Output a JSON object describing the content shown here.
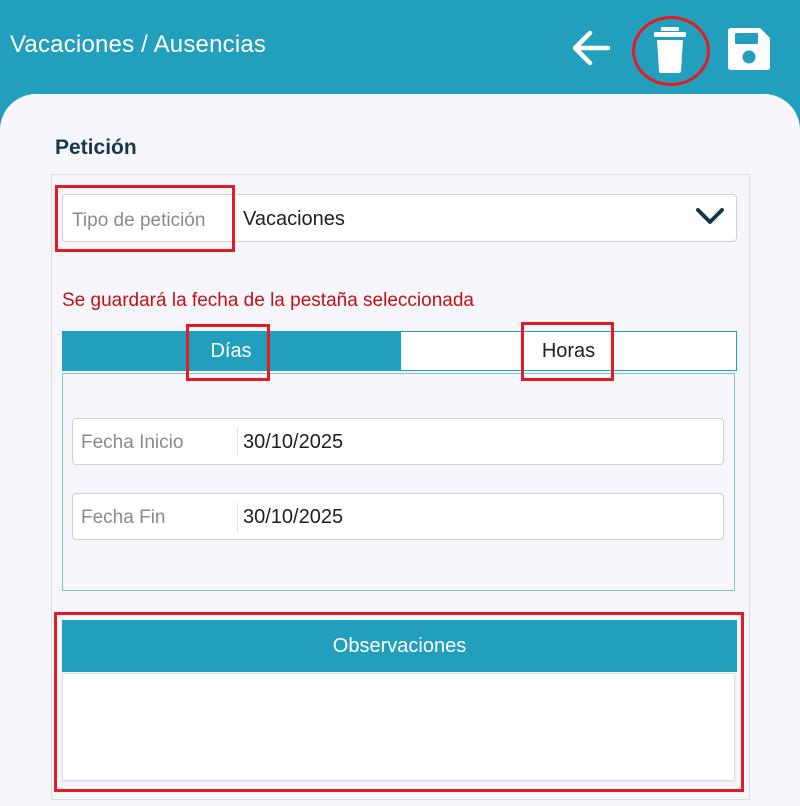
{
  "header": {
    "title": "Vacaciones / Ausencias",
    "back_icon": "arrow-left-icon",
    "delete_icon": "trash-icon",
    "save_icon": "floppy-disk-icon"
  },
  "form": {
    "section_title": "Petición",
    "request_type": {
      "label": "Tipo de petición",
      "value": "Vacaciones",
      "icon": "chevron-down-icon"
    },
    "notice": "Se guardará la fecha de la pestaña seleccionada",
    "tabs": [
      {
        "label": "Días",
        "selected": true
      },
      {
        "label": "Horas",
        "selected": false
      }
    ],
    "dates": {
      "start": {
        "label": "Fecha Inicio",
        "value": "30/10/2025"
      },
      "end": {
        "label": "Fecha Fin",
        "value": "30/10/2025"
      }
    },
    "observations": {
      "label": "Observaciones",
      "value": ""
    }
  },
  "colors": {
    "primary": "#229fbd",
    "sheet_background": "#f7f6fc",
    "notice_text": "#c21212",
    "highlight": "#e31b23",
    "section_title": "#17384a"
  }
}
